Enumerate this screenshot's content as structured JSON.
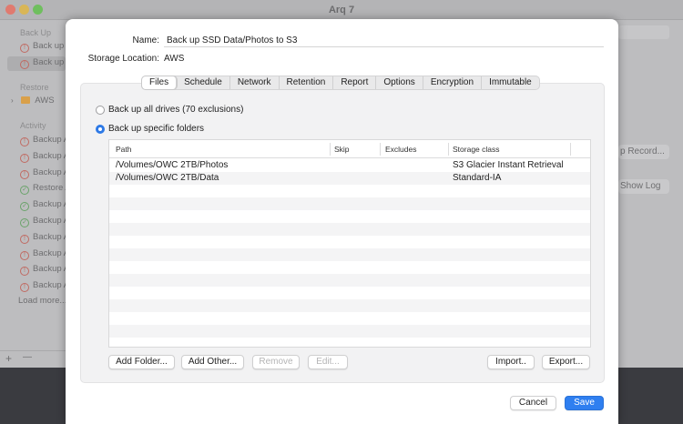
{
  "window": {
    "title": "Arq 7"
  },
  "sidebar": {
    "backup_header": "Back Up",
    "backup_items": [
      "Back up",
      "Back up"
    ],
    "restore_header": "Restore",
    "restore_item": "AWS",
    "activity_header": "Activity",
    "activity_items": [
      {
        "label": "Backup A",
        "status": "error"
      },
      {
        "label": "Backup A",
        "status": "error"
      },
      {
        "label": "Backup A",
        "status": "error"
      },
      {
        "label": "Restore A",
        "status": "ok"
      },
      {
        "label": "Backup A",
        "status": "ok"
      },
      {
        "label": "Backup A",
        "status": "ok"
      },
      {
        "label": "Backup A",
        "status": "error"
      },
      {
        "label": "Backup A",
        "status": "error"
      },
      {
        "label": "Backup A",
        "status": "error"
      },
      {
        "label": "Backup A",
        "status": "error"
      }
    ],
    "load_more": "Load more...",
    "add_symbol": "+",
    "remove_symbol": "—"
  },
  "background_buttons": {
    "record": "p Record...",
    "show_log": "Show Log"
  },
  "sheet": {
    "name_label": "Name:",
    "name_value": "Back up SSD Data/Photos to S3",
    "storage_label": "Storage Location:",
    "storage_value": "AWS",
    "tabs": [
      "Files",
      "Schedule",
      "Network",
      "Retention",
      "Report",
      "Options",
      "Encryption",
      "Immutable"
    ],
    "active_tab": "Files",
    "radio_all": "Back up all drives (70 exclusions)",
    "radio_specific": "Back up specific folders",
    "table": {
      "columns": [
        "Path",
        "Skip",
        "Excludes",
        "Storage class"
      ],
      "rows": [
        {
          "path": "/Volumes/OWC 2TB/Photos",
          "skip": "",
          "excludes": "",
          "storage_class": "S3 Glacier Instant Retrieval"
        },
        {
          "path": "/Volumes/OWC 2TB/Data",
          "skip": "",
          "excludes": "",
          "storage_class": "Standard-IA"
        }
      ]
    },
    "buttons": {
      "add_folder": "Add Folder...",
      "add_other": "Add Other...",
      "remove": "Remove",
      "edit": "Edit...",
      "import": "Import..",
      "export": "Export...",
      "cancel": "Cancel",
      "save": "Save"
    }
  },
  "colors": {
    "accent": "#2f7ff0",
    "error": "#c06a62",
    "ok": "#6aa36a"
  }
}
